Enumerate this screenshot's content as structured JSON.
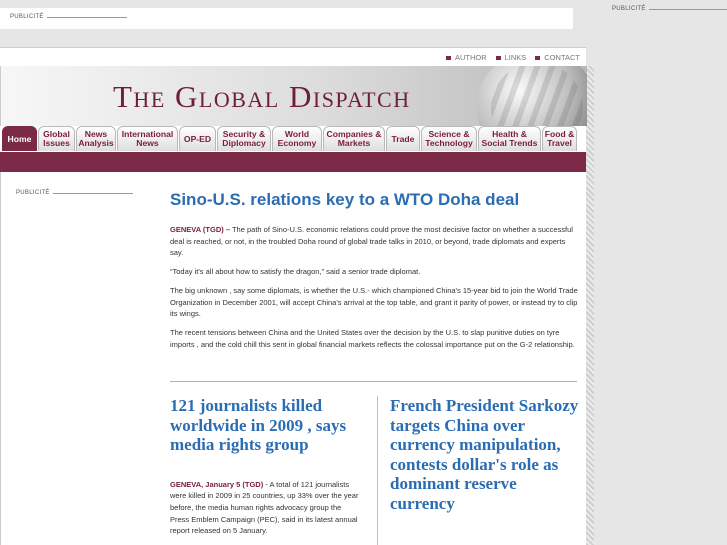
{
  "ads": {
    "top_label": "PUBLICITÉ",
    "right_label": "PUBLICITÉ",
    "sidebar_label": "PUBLICITÉ"
  },
  "util_links": [
    "AUTHOR",
    "LINKS",
    "CONTACT"
  ],
  "site_title": "The Global Dispatch",
  "nav_tabs": [
    "Home",
    "Global\nIssues",
    "News\nAnalysis",
    "International\nNews",
    "OP-ED",
    "Security &\nDiplomacy",
    "World\nEconomy",
    "Companies &\nMarkets",
    "Trade",
    "Science &\nTechnology",
    "Health &\nSocial Trends",
    "Food &\nTravel"
  ],
  "main_story": {
    "headline": "Sino-U.S. relations key to a WTO Doha deal",
    "dateline": "GENEVA (TGD) –",
    "p1": " The path of Sino-U.S. economic relations could prove the most decisive factor on whether a successful deal is reached, or not, in the troubled Doha round of global trade talks in 2010, or beyond, trade diplomats and experts say.",
    "p2": "“Today it's all about how to satisfy the dragon,” said a senior trade diplomat.",
    "p3": "The big unknown , say some diplomats, is whether the U.S.- which championed China's 15-year bid to join the World Trade Organization in December 2001, will accept China's arrival at the top table, and grant it parity of power, or instead try to clip its wings.",
    "p4": "The recent tensions between China and the United States over the decision by the U.S. to slap punitive duties on tyre imports , and the cold chill this sent in global financial markets reflects the colossal importance put on the G-2 relationship."
  },
  "story2": {
    "headline": "121 journalists killed worldwide in 2009 , says media rights group",
    "dateline": "GENEVA, January 5 (TGD)",
    "body": " - A total of 121 journalists were killed in 2009 in 25 countries, up 33% over the year before, the media human rights advocacy group the Press Emblem Campaign (PEC), said in its latest annual report released on 5 January."
  },
  "story3": {
    "headline": "French President Sarkozy targets China over currency manipulation, contests dollar's role as dominant reserve currency"
  }
}
